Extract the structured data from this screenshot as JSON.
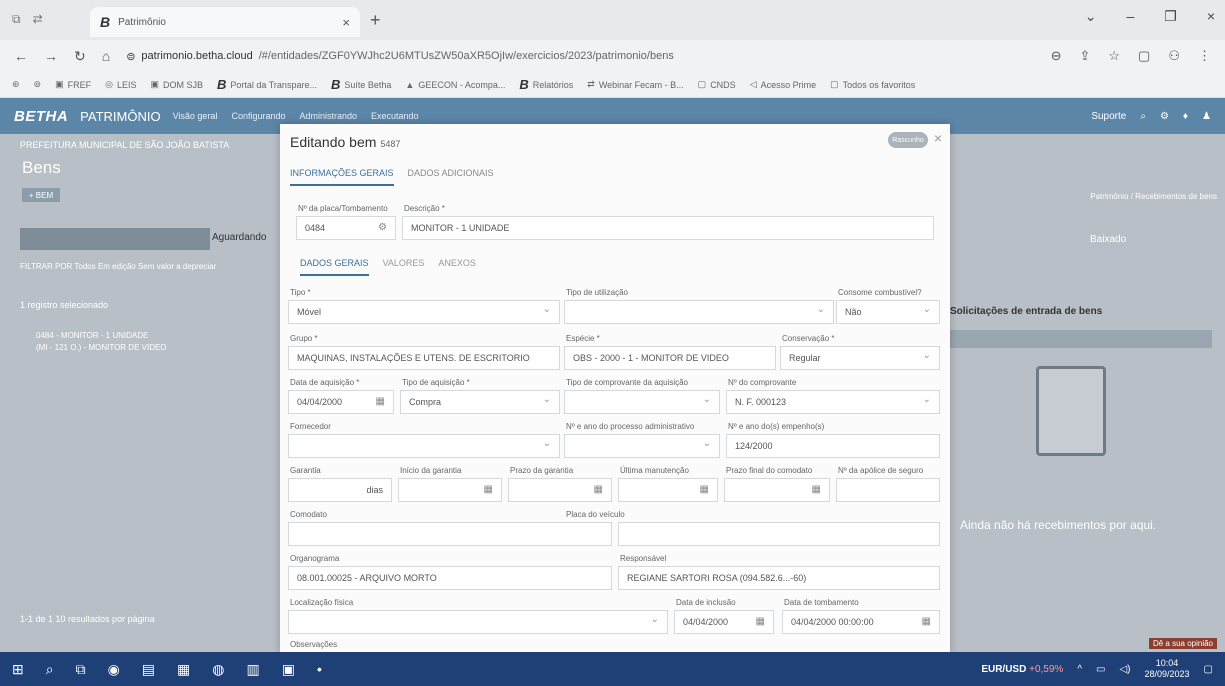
{
  "browser": {
    "tab_title": "Patrimônio",
    "url_host": "patrimonio.betha.cloud",
    "url_path": "/#/entidades/ZGF0YWJhc2U6MTUsZW50aXR5OjIw/exercicios/2023/patrimonio/bens",
    "bookmarks": [
      "FREF",
      "LEIS",
      "DOM SJB",
      "Portal da Transpare...",
      "Suíte Betha",
      "GEECON - Acompa...",
      "Relatórios",
      "Webinar Fecam - B...",
      "CNDS",
      "Acesso Prime",
      "Todos os favoritos"
    ]
  },
  "app": {
    "brand": "BETHA",
    "module": "PATRIMÔNIO",
    "menu": [
      "Visão geral",
      "Configurando",
      "Administrando",
      "Executando"
    ],
    "suporte": "Suporte"
  },
  "background": {
    "breadcrumb": "PREFEITURA MUNICIPAL DE SÃO JOÃO BATISTA",
    "page_title": "Bens",
    "new_button": "+ BEM",
    "aguardando": "Aguardando",
    "filter_label": "FILTRAR POR  Todos  Em edição  Sem valor a depreciar",
    "row1": "1 registro selecionado",
    "row2_line1": "0484 - MONITOR - 1 UNIDADE",
    "row2_line2": "(MI - 121 O.) - MONITOR DE VIDEO",
    "pager": "1-1 de 1   10   resultados por página",
    "right_breadcrumb": "Patrimônio / Recebimentos de bens",
    "baixado": "Baixado",
    "right_title": "Solicitações de entrada de bens",
    "empty": "Ainda não há recebimentos por aqui.",
    "footer_badge": "Dê a sua opinião"
  },
  "modal": {
    "title": "Editando bem",
    "code": "5487",
    "toggle": "Rascunho",
    "tabs": [
      "INFORMAÇÕES GERAIS",
      "DADOS ADICIONAIS"
    ],
    "placa_label": "Nº da placa/Tombamento",
    "placa_value": "0484",
    "descricao_label": "Descrição *",
    "descricao_value": "MONITOR - 1 UNIDADE",
    "subtabs": [
      "DADOS GERAIS",
      "VALORES",
      "ANEXOS"
    ],
    "tipo_label": "Tipo *",
    "tipo_value": "Móvel",
    "tipo_utilizacao_label": "Tipo de utilização",
    "consome_label": "Consome combustível?",
    "consome_value": "Não",
    "grupo_label": "Grupo *",
    "grupo_value": "MAQUINAS, INSTALAÇÕES E UTENS. DE ESCRITORIO",
    "especie_label": "Espécie *",
    "especie_value": "OBS - 2000 - 1 - MONITOR DE VIDEO",
    "conservacao_label": "Conservação *",
    "conservacao_value": "Regular",
    "data_aquisicao_label": "Data de aquisição *",
    "data_aquisicao_value": "04/04/2000",
    "tipo_aquisicao_label": "Tipo de aquisição *",
    "tipo_aquisicao_value": "Compra",
    "tipo_comprovante_label": "Tipo de comprovante da aquisição",
    "num_comprovante_label": "Nº do comprovante",
    "num_comprovante_value": "N. F. 000123",
    "fornecedor_label": "Fornecedor",
    "num_processo_label": "Nº e ano do processo administrativo",
    "num_empenho_label": "Nº e ano do(s) empenho(s)",
    "num_empenho_value": "124/2000",
    "garantia_label": "Garantia",
    "garantia_unit": "dias",
    "inicio_garantia_label": "Início da garantia",
    "prazo_garantia_label": "Prazo da garantia",
    "ultima_manutencao_label": "Última manutenção",
    "prazo_comodato_label": "Prazo final do comodato",
    "apolice_label": "Nº da apólice de seguro",
    "comodato_label": "Comodato",
    "placa_veiculo_label": "Placa do veículo",
    "organograma_label": "Organograma",
    "organograma_value": "08.001.00025 - ARQUIVO MORTO",
    "responsavel_label": "Responsável",
    "responsavel_value": "REGIANE SARTORI ROSA (094.582.6...-60)",
    "localizacao_label": "Localização física",
    "data_inclusao_label": "Data de inclusão",
    "data_inclusao_value": "04/04/2000",
    "data_tombamento_label": "Data de tombamento",
    "data_tombamento_value": "04/04/2000 00:00:00",
    "observacoes_label": "Observações"
  },
  "taskbar": {
    "eurusd": "EUR/USD",
    "pct": "+0,59%",
    "time": "10:04",
    "date": "28/09/2023"
  }
}
